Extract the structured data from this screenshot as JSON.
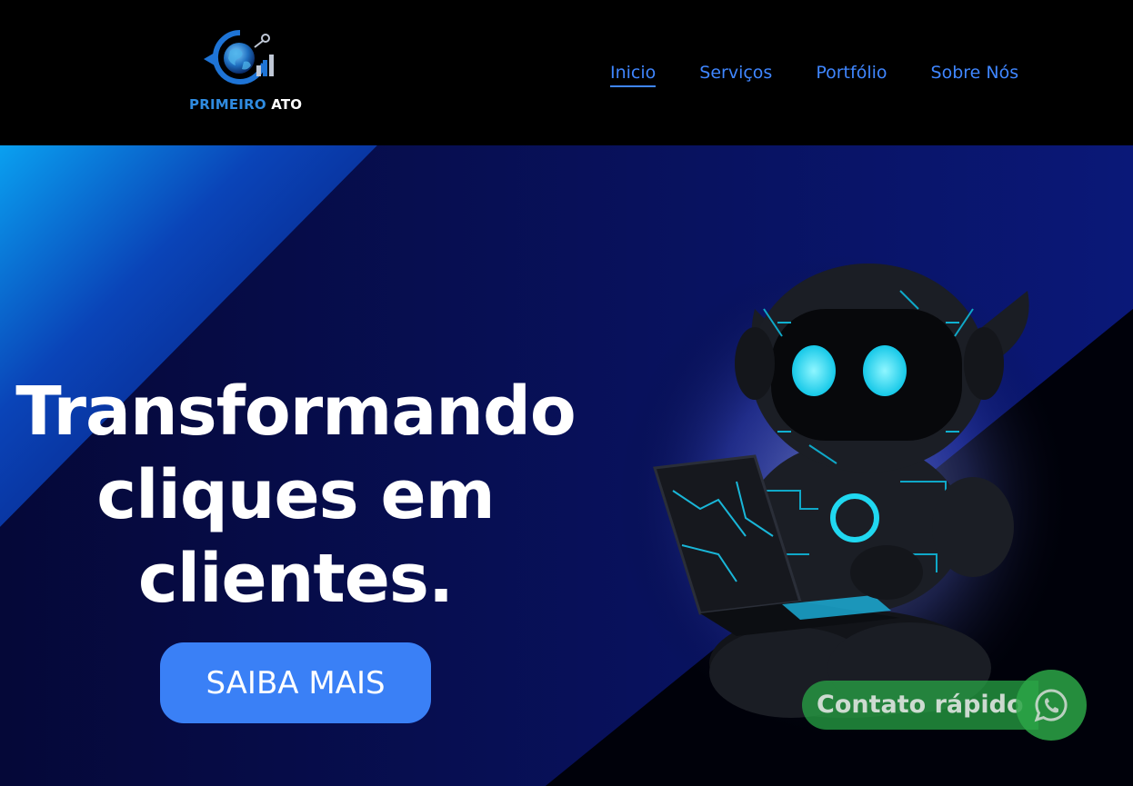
{
  "brand": {
    "name_part1": "PRIMEIRO",
    "name_part2": "ATO",
    "accent_color": "#2f8be0"
  },
  "nav": {
    "items": [
      {
        "label": "Inicio",
        "active": true
      },
      {
        "label": "Serviços",
        "active": false
      },
      {
        "label": "Portfólio",
        "active": false
      },
      {
        "label": "Sobre Nós",
        "active": false
      }
    ],
    "link_color": "#3f86ff"
  },
  "hero": {
    "headline_lines": [
      "Transformando",
      "cliques em",
      "clientes."
    ],
    "cta_label": "SAIBA MAIS",
    "cta_color": "#3a80f6"
  },
  "contact": {
    "label": "Contato rápido",
    "icon": "whatsapp-icon",
    "color": "#2ca646"
  }
}
